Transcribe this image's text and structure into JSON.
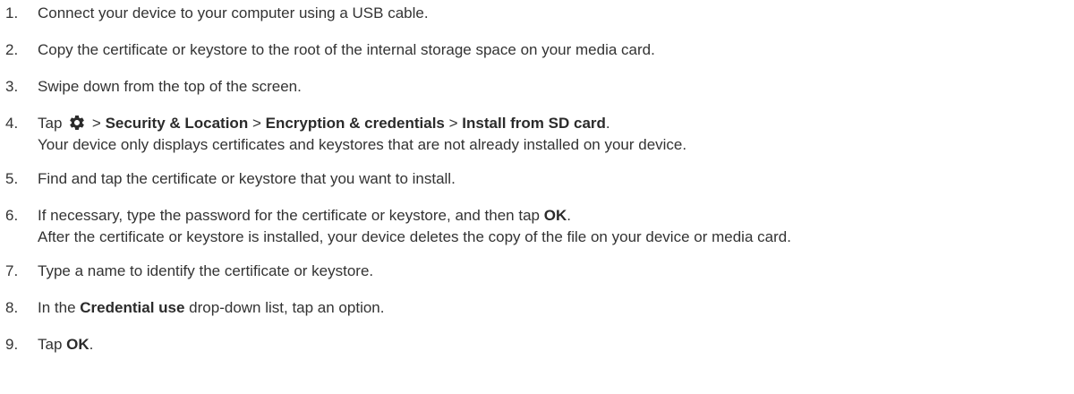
{
  "steps": [
    {
      "number": "1.",
      "text": "Connect your device to your computer using a USB cable."
    },
    {
      "number": "2.",
      "text": "Copy the certificate or keystore to the root of the internal storage space on your media card."
    },
    {
      "number": "3.",
      "text": "Swipe down from the top of the screen."
    },
    {
      "number": "4.",
      "tap": "Tap",
      "icon": "gear-icon",
      "sep": ">",
      "path1": "Security & Location",
      "path2": "Encryption & credentials",
      "path3": "Install from SD card",
      "end": ".",
      "note": "Your device only displays certificates and keystores that are not already installed on your device."
    },
    {
      "number": "5.",
      "text": "Find and tap the certificate or keystore that you want to install."
    },
    {
      "number": "6.",
      "pre": "If necessary, type the password for the certificate or keystore, and then tap",
      "bold": "OK",
      "end": ".",
      "note": "After the certificate or keystore is installed, your device deletes the copy of the file on your device or media card."
    },
    {
      "number": "7.",
      "text": "Type a name to identify the certificate or keystore."
    },
    {
      "number": "8.",
      "pre": "In the",
      "bold": "Credential use",
      "post": "drop-down list, tap an option."
    },
    {
      "number": "9.",
      "pre": "Tap",
      "bold": "OK",
      "end": "."
    }
  ]
}
